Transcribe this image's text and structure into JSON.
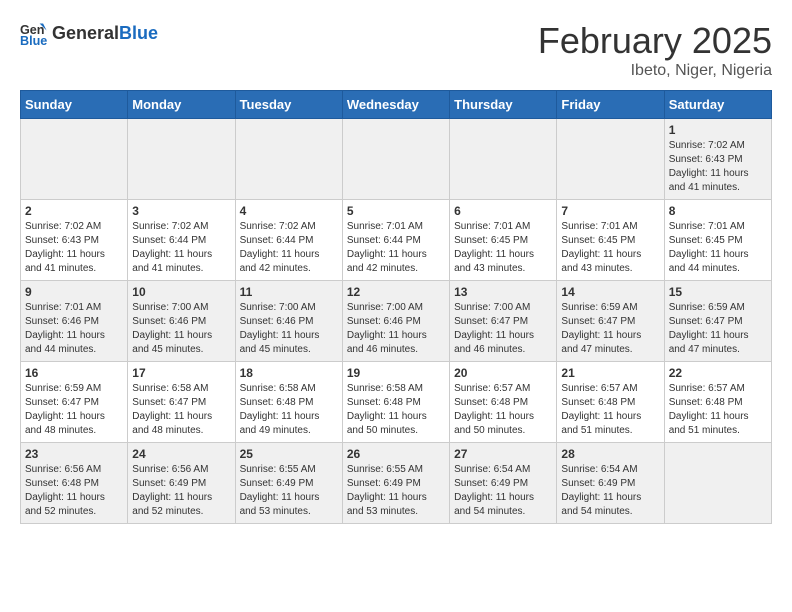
{
  "header": {
    "logo_general": "General",
    "logo_blue": "Blue",
    "month": "February 2025",
    "location": "Ibeto, Niger, Nigeria"
  },
  "weekdays": [
    "Sunday",
    "Monday",
    "Tuesday",
    "Wednesday",
    "Thursday",
    "Friday",
    "Saturday"
  ],
  "weeks": [
    [
      {
        "day": "",
        "info": ""
      },
      {
        "day": "",
        "info": ""
      },
      {
        "day": "",
        "info": ""
      },
      {
        "day": "",
        "info": ""
      },
      {
        "day": "",
        "info": ""
      },
      {
        "day": "",
        "info": ""
      },
      {
        "day": "1",
        "info": "Sunrise: 7:02 AM\nSunset: 6:43 PM\nDaylight: 11 hours and 41 minutes."
      }
    ],
    [
      {
        "day": "2",
        "info": "Sunrise: 7:02 AM\nSunset: 6:43 PM\nDaylight: 11 hours and 41 minutes."
      },
      {
        "day": "3",
        "info": "Sunrise: 7:02 AM\nSunset: 6:44 PM\nDaylight: 11 hours and 41 minutes."
      },
      {
        "day": "4",
        "info": "Sunrise: 7:02 AM\nSunset: 6:44 PM\nDaylight: 11 hours and 42 minutes."
      },
      {
        "day": "5",
        "info": "Sunrise: 7:01 AM\nSunset: 6:44 PM\nDaylight: 11 hours and 42 minutes."
      },
      {
        "day": "6",
        "info": "Sunrise: 7:01 AM\nSunset: 6:45 PM\nDaylight: 11 hours and 43 minutes."
      },
      {
        "day": "7",
        "info": "Sunrise: 7:01 AM\nSunset: 6:45 PM\nDaylight: 11 hours and 43 minutes."
      },
      {
        "day": "8",
        "info": "Sunrise: 7:01 AM\nSunset: 6:45 PM\nDaylight: 11 hours and 44 minutes."
      }
    ],
    [
      {
        "day": "9",
        "info": "Sunrise: 7:01 AM\nSunset: 6:46 PM\nDaylight: 11 hours and 44 minutes."
      },
      {
        "day": "10",
        "info": "Sunrise: 7:00 AM\nSunset: 6:46 PM\nDaylight: 11 hours and 45 minutes."
      },
      {
        "day": "11",
        "info": "Sunrise: 7:00 AM\nSunset: 6:46 PM\nDaylight: 11 hours and 45 minutes."
      },
      {
        "day": "12",
        "info": "Sunrise: 7:00 AM\nSunset: 6:46 PM\nDaylight: 11 hours and 46 minutes."
      },
      {
        "day": "13",
        "info": "Sunrise: 7:00 AM\nSunset: 6:47 PM\nDaylight: 11 hours and 46 minutes."
      },
      {
        "day": "14",
        "info": "Sunrise: 6:59 AM\nSunset: 6:47 PM\nDaylight: 11 hours and 47 minutes."
      },
      {
        "day": "15",
        "info": "Sunrise: 6:59 AM\nSunset: 6:47 PM\nDaylight: 11 hours and 47 minutes."
      }
    ],
    [
      {
        "day": "16",
        "info": "Sunrise: 6:59 AM\nSunset: 6:47 PM\nDaylight: 11 hours and 48 minutes."
      },
      {
        "day": "17",
        "info": "Sunrise: 6:58 AM\nSunset: 6:47 PM\nDaylight: 11 hours and 48 minutes."
      },
      {
        "day": "18",
        "info": "Sunrise: 6:58 AM\nSunset: 6:48 PM\nDaylight: 11 hours and 49 minutes."
      },
      {
        "day": "19",
        "info": "Sunrise: 6:58 AM\nSunset: 6:48 PM\nDaylight: 11 hours and 50 minutes."
      },
      {
        "day": "20",
        "info": "Sunrise: 6:57 AM\nSunset: 6:48 PM\nDaylight: 11 hours and 50 minutes."
      },
      {
        "day": "21",
        "info": "Sunrise: 6:57 AM\nSunset: 6:48 PM\nDaylight: 11 hours and 51 minutes."
      },
      {
        "day": "22",
        "info": "Sunrise: 6:57 AM\nSunset: 6:48 PM\nDaylight: 11 hours and 51 minutes."
      }
    ],
    [
      {
        "day": "23",
        "info": "Sunrise: 6:56 AM\nSunset: 6:48 PM\nDaylight: 11 hours and 52 minutes."
      },
      {
        "day": "24",
        "info": "Sunrise: 6:56 AM\nSunset: 6:49 PM\nDaylight: 11 hours and 52 minutes."
      },
      {
        "day": "25",
        "info": "Sunrise: 6:55 AM\nSunset: 6:49 PM\nDaylight: 11 hours and 53 minutes."
      },
      {
        "day": "26",
        "info": "Sunrise: 6:55 AM\nSunset: 6:49 PM\nDaylight: 11 hours and 53 minutes."
      },
      {
        "day": "27",
        "info": "Sunrise: 6:54 AM\nSunset: 6:49 PM\nDaylight: 11 hours and 54 minutes."
      },
      {
        "day": "28",
        "info": "Sunrise: 6:54 AM\nSunset: 6:49 PM\nDaylight: 11 hours and 54 minutes."
      },
      {
        "day": "",
        "info": ""
      }
    ]
  ]
}
